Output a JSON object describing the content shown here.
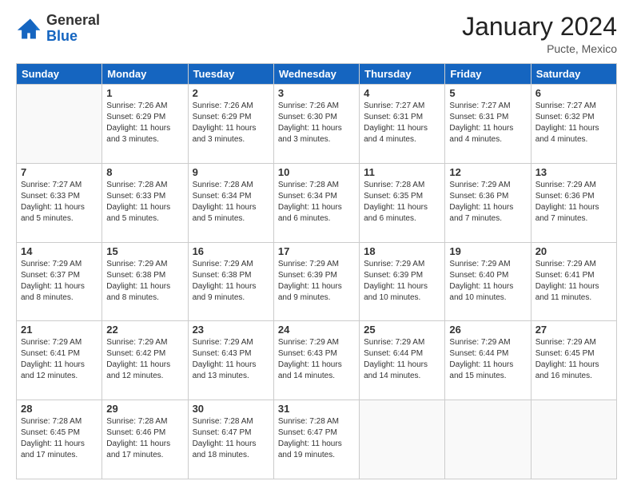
{
  "header": {
    "logo_general": "General",
    "logo_blue": "Blue",
    "month_year": "January 2024",
    "location": "Pucte, Mexico"
  },
  "days_of_week": [
    "Sunday",
    "Monday",
    "Tuesday",
    "Wednesday",
    "Thursday",
    "Friday",
    "Saturday"
  ],
  "weeks": [
    [
      {
        "num": "",
        "info": ""
      },
      {
        "num": "1",
        "info": "Sunrise: 7:26 AM\nSunset: 6:29 PM\nDaylight: 11 hours\nand 3 minutes."
      },
      {
        "num": "2",
        "info": "Sunrise: 7:26 AM\nSunset: 6:29 PM\nDaylight: 11 hours\nand 3 minutes."
      },
      {
        "num": "3",
        "info": "Sunrise: 7:26 AM\nSunset: 6:30 PM\nDaylight: 11 hours\nand 3 minutes."
      },
      {
        "num": "4",
        "info": "Sunrise: 7:27 AM\nSunset: 6:31 PM\nDaylight: 11 hours\nand 4 minutes."
      },
      {
        "num": "5",
        "info": "Sunrise: 7:27 AM\nSunset: 6:31 PM\nDaylight: 11 hours\nand 4 minutes."
      },
      {
        "num": "6",
        "info": "Sunrise: 7:27 AM\nSunset: 6:32 PM\nDaylight: 11 hours\nand 4 minutes."
      }
    ],
    [
      {
        "num": "7",
        "info": "Sunrise: 7:27 AM\nSunset: 6:33 PM\nDaylight: 11 hours\nand 5 minutes."
      },
      {
        "num": "8",
        "info": "Sunrise: 7:28 AM\nSunset: 6:33 PM\nDaylight: 11 hours\nand 5 minutes."
      },
      {
        "num": "9",
        "info": "Sunrise: 7:28 AM\nSunset: 6:34 PM\nDaylight: 11 hours\nand 5 minutes."
      },
      {
        "num": "10",
        "info": "Sunrise: 7:28 AM\nSunset: 6:34 PM\nDaylight: 11 hours\nand 6 minutes."
      },
      {
        "num": "11",
        "info": "Sunrise: 7:28 AM\nSunset: 6:35 PM\nDaylight: 11 hours\nand 6 minutes."
      },
      {
        "num": "12",
        "info": "Sunrise: 7:29 AM\nSunset: 6:36 PM\nDaylight: 11 hours\nand 7 minutes."
      },
      {
        "num": "13",
        "info": "Sunrise: 7:29 AM\nSunset: 6:36 PM\nDaylight: 11 hours\nand 7 minutes."
      }
    ],
    [
      {
        "num": "14",
        "info": "Sunrise: 7:29 AM\nSunset: 6:37 PM\nDaylight: 11 hours\nand 8 minutes."
      },
      {
        "num": "15",
        "info": "Sunrise: 7:29 AM\nSunset: 6:38 PM\nDaylight: 11 hours\nand 8 minutes."
      },
      {
        "num": "16",
        "info": "Sunrise: 7:29 AM\nSunset: 6:38 PM\nDaylight: 11 hours\nand 9 minutes."
      },
      {
        "num": "17",
        "info": "Sunrise: 7:29 AM\nSunset: 6:39 PM\nDaylight: 11 hours\nand 9 minutes."
      },
      {
        "num": "18",
        "info": "Sunrise: 7:29 AM\nSunset: 6:39 PM\nDaylight: 11 hours\nand 10 minutes."
      },
      {
        "num": "19",
        "info": "Sunrise: 7:29 AM\nSunset: 6:40 PM\nDaylight: 11 hours\nand 10 minutes."
      },
      {
        "num": "20",
        "info": "Sunrise: 7:29 AM\nSunset: 6:41 PM\nDaylight: 11 hours\nand 11 minutes."
      }
    ],
    [
      {
        "num": "21",
        "info": "Sunrise: 7:29 AM\nSunset: 6:41 PM\nDaylight: 11 hours\nand 12 minutes."
      },
      {
        "num": "22",
        "info": "Sunrise: 7:29 AM\nSunset: 6:42 PM\nDaylight: 11 hours\nand 12 minutes."
      },
      {
        "num": "23",
        "info": "Sunrise: 7:29 AM\nSunset: 6:43 PM\nDaylight: 11 hours\nand 13 minutes."
      },
      {
        "num": "24",
        "info": "Sunrise: 7:29 AM\nSunset: 6:43 PM\nDaylight: 11 hours\nand 14 minutes."
      },
      {
        "num": "25",
        "info": "Sunrise: 7:29 AM\nSunset: 6:44 PM\nDaylight: 11 hours\nand 14 minutes."
      },
      {
        "num": "26",
        "info": "Sunrise: 7:29 AM\nSunset: 6:44 PM\nDaylight: 11 hours\nand 15 minutes."
      },
      {
        "num": "27",
        "info": "Sunrise: 7:29 AM\nSunset: 6:45 PM\nDaylight: 11 hours\nand 16 minutes."
      }
    ],
    [
      {
        "num": "28",
        "info": "Sunrise: 7:28 AM\nSunset: 6:45 PM\nDaylight: 11 hours\nand 17 minutes."
      },
      {
        "num": "29",
        "info": "Sunrise: 7:28 AM\nSunset: 6:46 PM\nDaylight: 11 hours\nand 17 minutes."
      },
      {
        "num": "30",
        "info": "Sunrise: 7:28 AM\nSunset: 6:47 PM\nDaylight: 11 hours\nand 18 minutes."
      },
      {
        "num": "31",
        "info": "Sunrise: 7:28 AM\nSunset: 6:47 PM\nDaylight: 11 hours\nand 19 minutes."
      },
      {
        "num": "",
        "info": ""
      },
      {
        "num": "",
        "info": ""
      },
      {
        "num": "",
        "info": ""
      }
    ]
  ]
}
